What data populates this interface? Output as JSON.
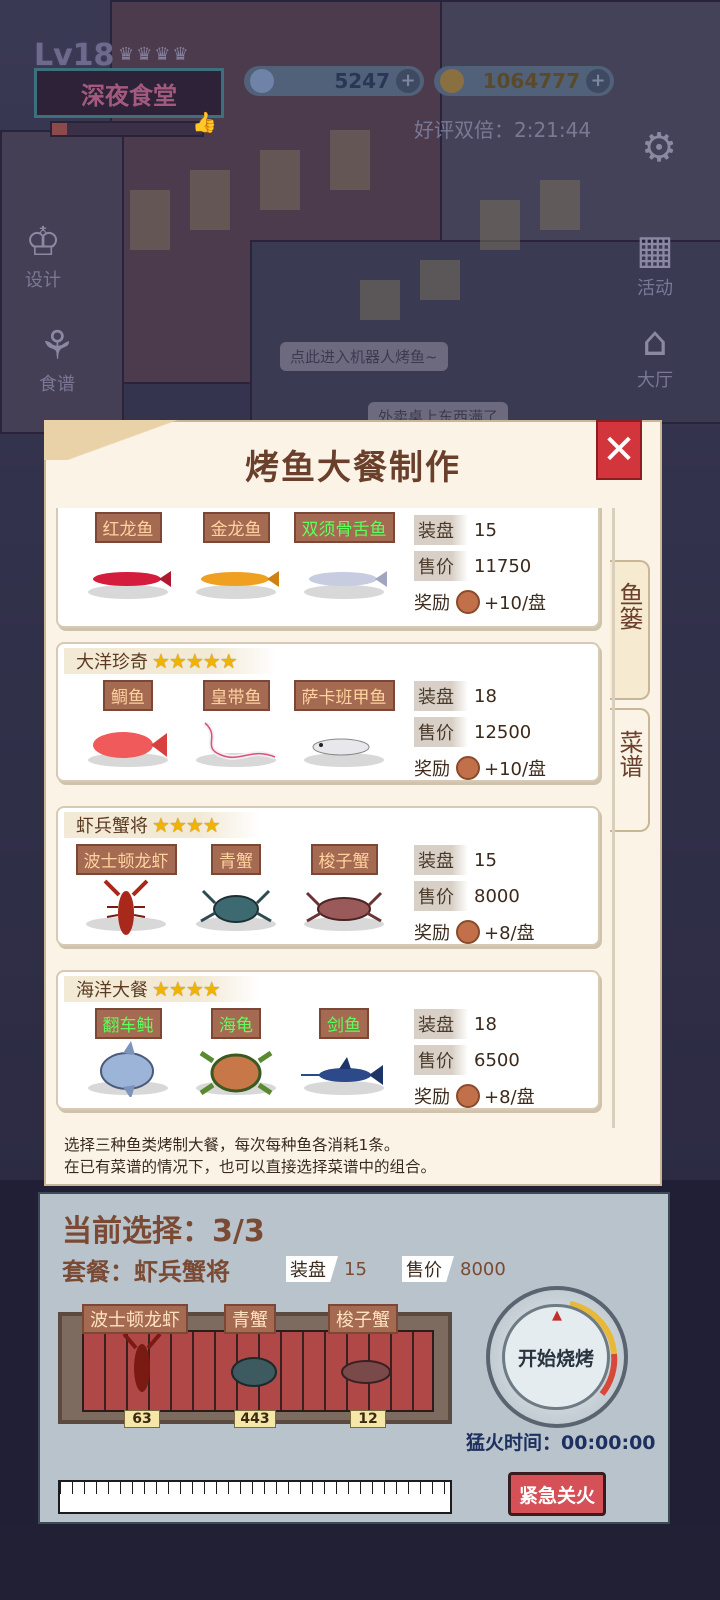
{
  "hud": {
    "level": "Lv18",
    "shop_name": "深夜食堂",
    "xp_progress": 0.1,
    "diamonds": "5247",
    "coins": "1064777",
    "review_timer": "好评双倍：2:21:44",
    "side_left": [
      "设计",
      "食谱"
    ],
    "side_right": [
      "活动",
      "大厅"
    ],
    "bubble_1": "点此进入机器人烤鱼~",
    "bubble_2": "外卖桌上东西满了"
  },
  "dialog": {
    "title": "烤鱼大餐制作",
    "close_icon": "close-x-icon",
    "tabs": [
      "鱼篓",
      "菜谱"
    ],
    "stat_labels": {
      "plate": "装盘",
      "price": "售价",
      "reward": "奖励"
    },
    "meals": [
      {
        "name": "",
        "stars": 0,
        "fish": [
          {
            "name": "红龙鱼",
            "tag_color": "orange"
          },
          {
            "name": "金龙鱼",
            "tag_color": "orange"
          },
          {
            "name": "双须骨舌鱼",
            "tag_color": "green"
          }
        ],
        "plate": "15",
        "price": "11750",
        "reward": "+10/盘"
      },
      {
        "name": "大洋珍奇",
        "stars": 5,
        "star_text": "★★★★★",
        "fish": [
          {
            "name": "鲷鱼",
            "tag_color": "orange"
          },
          {
            "name": "皇带鱼",
            "tag_color": "orange"
          },
          {
            "name": "萨卡班甲鱼",
            "tag_color": "orange"
          }
        ],
        "plate": "18",
        "price": "12500",
        "reward": "+10/盘"
      },
      {
        "name": "虾兵蟹将",
        "stars": 4,
        "star_text": "★★★★",
        "fish": [
          {
            "name": "波士顿龙虾",
            "tag_color": "orange"
          },
          {
            "name": "青蟹",
            "tag_color": "orange"
          },
          {
            "name": "梭子蟹",
            "tag_color": "orange"
          }
        ],
        "plate": "15",
        "price": "8000",
        "reward": "+8/盘"
      },
      {
        "name": "海洋大餐",
        "stars": 4,
        "star_text": "★★★★",
        "fish": [
          {
            "name": "翻车鲀",
            "tag_color": "green"
          },
          {
            "name": "海龟",
            "tag_color": "green"
          },
          {
            "name": "剑鱼",
            "tag_color": "green"
          }
        ],
        "plate": "18",
        "price": "6500",
        "reward": "+8/盘"
      }
    ],
    "description_1": "选择三种鱼类烤制大餐，每次每种鱼各消耗1条。",
    "description_2": "在已有菜谱的情况下，也可以直接选择菜谱中的组合。"
  },
  "cooking": {
    "current_selection": "当前选择：3/3",
    "combo": "套餐：虾兵蟹将",
    "plate_label": "装盘",
    "plate": "15",
    "price_label": "售价",
    "price": "8000",
    "slots": [
      {
        "name": "波士顿龙虾",
        "count": "63"
      },
      {
        "name": "青蟹",
        "count": "443"
      },
      {
        "name": "梭子蟹",
        "count": "12"
      }
    ],
    "start_button": "开始烧烤",
    "fire_time": "猛火时间：00:00:00",
    "stop_button": "紧急关火"
  },
  "colors": {
    "title_brown": "#6a3f2c",
    "close_red": "#d2363c",
    "star_gold": "#f0b400",
    "tag_bg": "#a56a52",
    "green_text": "#5cff5c"
  }
}
